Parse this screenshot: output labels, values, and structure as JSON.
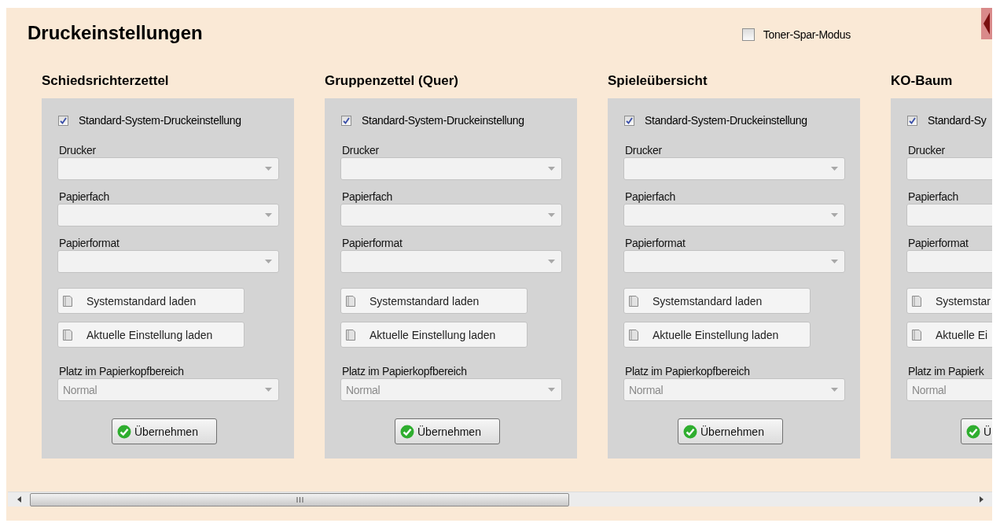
{
  "title": "Druckeinstellungen",
  "toner_saving": {
    "label": "Toner-Spar-Modus",
    "checked": false
  },
  "sections": [
    {
      "heading": "Schiedsrichterzettel",
      "use_system_default": {
        "label": "Standard-System-Druckeinstellung",
        "checked": true
      },
      "fields": [
        {
          "label": "Drucker"
        },
        {
          "label": "Papierfach"
        },
        {
          "label": "Papierformat"
        }
      ],
      "buttons": [
        "Systemstandard laden",
        "Aktuelle Einstellung laden"
      ],
      "header_space": {
        "label": "Platz im Papierkopfbereich",
        "value": "Normal",
        "disabled": true
      },
      "apply_button": "Übernehmen"
    },
    {
      "heading": "Gruppenzettel (Quer)",
      "use_system_default": {
        "label": "Standard-System-Druckeinstellung",
        "checked": true
      },
      "fields": [
        {
          "label": "Drucker"
        },
        {
          "label": "Papierfach"
        },
        {
          "label": "Papierformat"
        }
      ],
      "buttons": [
        "Systemstandard laden",
        "Aktuelle Einstellung laden"
      ],
      "header_space": {
        "label": "Platz im Papierkopfbereich",
        "value": "Normal",
        "disabled": true
      },
      "apply_button": "Übernehmen"
    },
    {
      "heading": "Spieleübersicht",
      "use_system_default": {
        "label": "Standard-System-Druckeinstellung",
        "checked": true
      },
      "fields": [
        {
          "label": "Drucker"
        },
        {
          "label": "Papierfach"
        },
        {
          "label": "Papierformat"
        }
      ],
      "buttons": [
        "Systemstandard laden",
        "Aktuelle Einstellung laden"
      ],
      "header_space": {
        "label": "Platz im Papierkopfbereich",
        "value": "Normal",
        "disabled": true
      },
      "apply_button": "Übernehmen"
    },
    {
      "heading": "KO-Baum",
      "use_system_default": {
        "label": "Standard-Sy",
        "checked": true
      },
      "fields": [
        {
          "label": "Drucker"
        },
        {
          "label": "Papierfach"
        },
        {
          "label": "Papierformat"
        }
      ],
      "buttons": [
        "Systemstar",
        "Aktuelle Ei"
      ],
      "header_space": {
        "label": "Platz im Papierk",
        "value": "Normal",
        "disabled": true
      },
      "apply_button": "Ü"
    }
  ]
}
